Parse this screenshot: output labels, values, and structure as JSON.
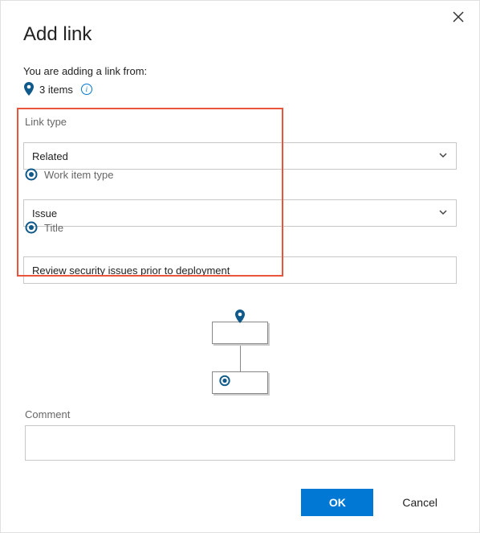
{
  "dialog": {
    "title": "Add link",
    "subtext": "You are adding a link from:",
    "items_count": "3 items"
  },
  "fields": {
    "link_type_label": "Link type",
    "link_type_value": "Related",
    "work_item_type_label": "Work item type",
    "work_item_type_value": "Issue",
    "title_label": "Title",
    "title_value": "Review security issues prior to deployment",
    "comment_label": "Comment",
    "comment_value": ""
  },
  "buttons": {
    "ok": "OK",
    "cancel": "Cancel"
  }
}
